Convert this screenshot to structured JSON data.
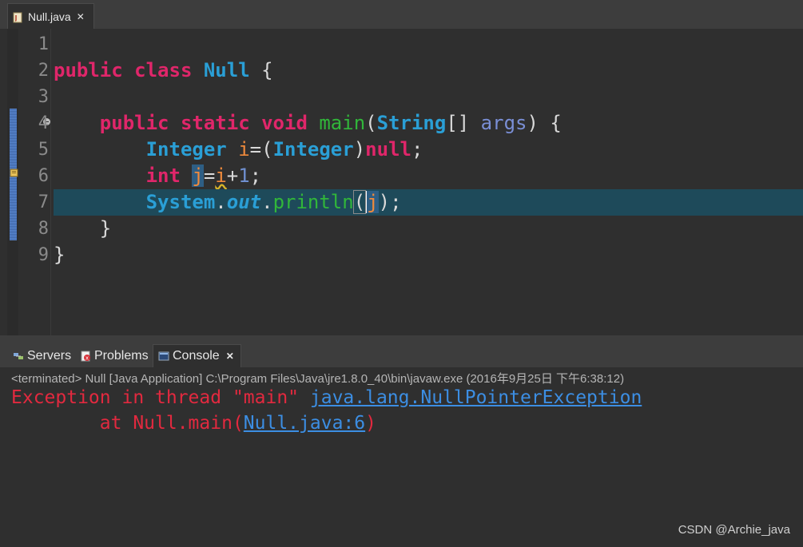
{
  "editor_tab": {
    "label": "Null.java",
    "close": "✕"
  },
  "line_numbers": [
    "1",
    "2",
    "3",
    "4",
    "5",
    "6",
    "7",
    "8",
    "9"
  ],
  "code": {
    "l2": {
      "kw1": "public",
      "kw2": "class",
      "name": "Null",
      "brace": "{"
    },
    "l4": {
      "kw1": "public",
      "kw2": "static",
      "kw3": "void",
      "fn": "main",
      "p1": "(",
      "type": "String",
      "arr": "[] ",
      "param": "args",
      "p2": ") {"
    },
    "l5": {
      "type": "Integer",
      "var": "i",
      "eq": "=(",
      "cast": "Integer",
      "close": ")",
      "nul": "null",
      "semi": ";"
    },
    "l6": {
      "kw": "int",
      "var": "j",
      "eq": "=",
      "ref": "i",
      "plus": "+",
      "num": "1",
      "semi": ";"
    },
    "l7": {
      "cls": "System",
      "dot1": ".",
      "field": "out",
      "dot2": ".",
      "fn": "println",
      "open": "(",
      "arg": "j",
      "close": ");"
    },
    "l8": {
      "brace": "}"
    },
    "l9": {
      "brace": "}"
    }
  },
  "console_tabs": [
    {
      "label": "Servers"
    },
    {
      "label": "Problems"
    },
    {
      "label": "Console",
      "close": "✕"
    }
  ],
  "console": {
    "status": "<terminated> Null [Java Application] C:\\Program Files\\Java\\jre1.8.0_40\\bin\\javaw.exe (2016年9月25日 下午6:38:12)",
    "line1_prefix": "Exception in thread \"main\" ",
    "line1_link": "java.lang.NullPointerException",
    "line2_prefix": "        at Null.main(",
    "line2_link": "Null.java:6",
    "line2_suffix": ")"
  },
  "watermark": "CSDN @Archie_java",
  "colors": {
    "keyword": "#e0266a",
    "type": "#2a9fd6",
    "method": "#31b63a",
    "local_var": "#f08a3c",
    "error": "#e2293f",
    "link": "#3c8ee3",
    "current_line": "#1e4a5a"
  }
}
